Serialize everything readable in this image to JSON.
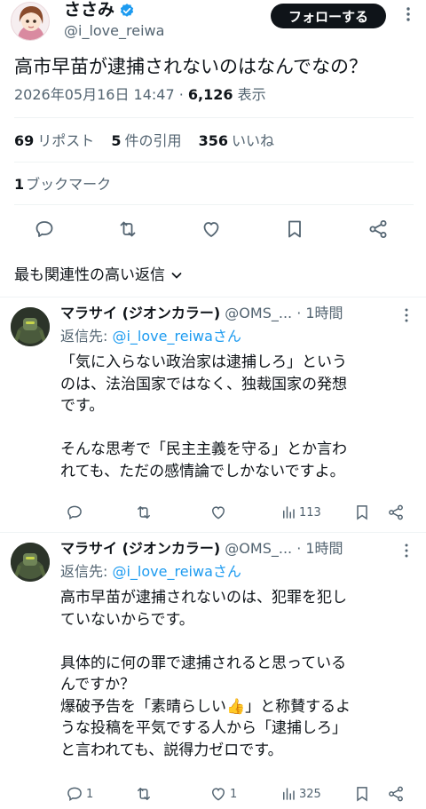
{
  "tweet": {
    "author_name": "ささみ",
    "author_handle": "@i_love_reiwa",
    "follow_label": "フォローする",
    "text": "高市早苗が逮捕されないのはなんでなの？",
    "timestamp": "2026年05月16日 14:47",
    "separator": " · ",
    "views_count": "6,126",
    "views_label": " 表示",
    "reposts_count": "69",
    "reposts_label": "リポスト",
    "quotes_count": "5",
    "quotes_label": "件の引用",
    "likes_count": "356",
    "likes_label": "いいね",
    "bookmarks_count": "1",
    "bookmarks_label": "ブックマーク"
  },
  "sort": {
    "label": "最も関連性の高い返信"
  },
  "icons": {
    "verified": "verified-badge-icon",
    "more": "more-vertical-icon",
    "reply": "reply-icon",
    "repost": "repost-icon",
    "like": "like-icon",
    "bookmark": "bookmark-icon",
    "share": "share-icon",
    "views": "views-chart-icon",
    "chevron": "chevron-down-icon"
  },
  "colors": {
    "accent": "#1d9bf0",
    "text": "#0f1419",
    "muted": "#536471",
    "divider": "#eff3f4"
  },
  "replies": [
    {
      "name": "マラサイ (ジオンカラー)",
      "handle": "@OMS_...",
      "time": "· 1時間",
      "reply_to_prefix": "返信先: ",
      "reply_to_handle": "@i_love_reiwaさん",
      "lines": [
        "「気に入らない政治家は逮捕しろ」という",
        "のは、法治国家ではなく、独裁国家の発想",
        "です。",
        "",
        "そんな思考で「民主主義を守る」とか言わ",
        "れても、ただの感情論でしかないですよ。"
      ],
      "reply_count": "",
      "repost_count": "",
      "like_count": "",
      "views_count": "113"
    },
    {
      "name": "マラサイ (ジオンカラー)",
      "handle": "@OMS_...",
      "time": "· 1時間",
      "reply_to_prefix": "返信先: ",
      "reply_to_handle": "@i_love_reiwaさん",
      "lines": [
        "高市早苗が逮捕されないのは、犯罪を犯し",
        "ていないからです。",
        "",
        "具体的に何の罪で逮捕されると思っている",
        "んですか？",
        "爆破予告を「素晴らしい👍」と称賛するよ",
        "うな投稿を平気でする人から「逮捕しろ」",
        "と言われても、説得力ゼロです。"
      ],
      "reply_count": "1",
      "repost_count": "",
      "like_count": "1",
      "views_count": "325"
    }
  ]
}
